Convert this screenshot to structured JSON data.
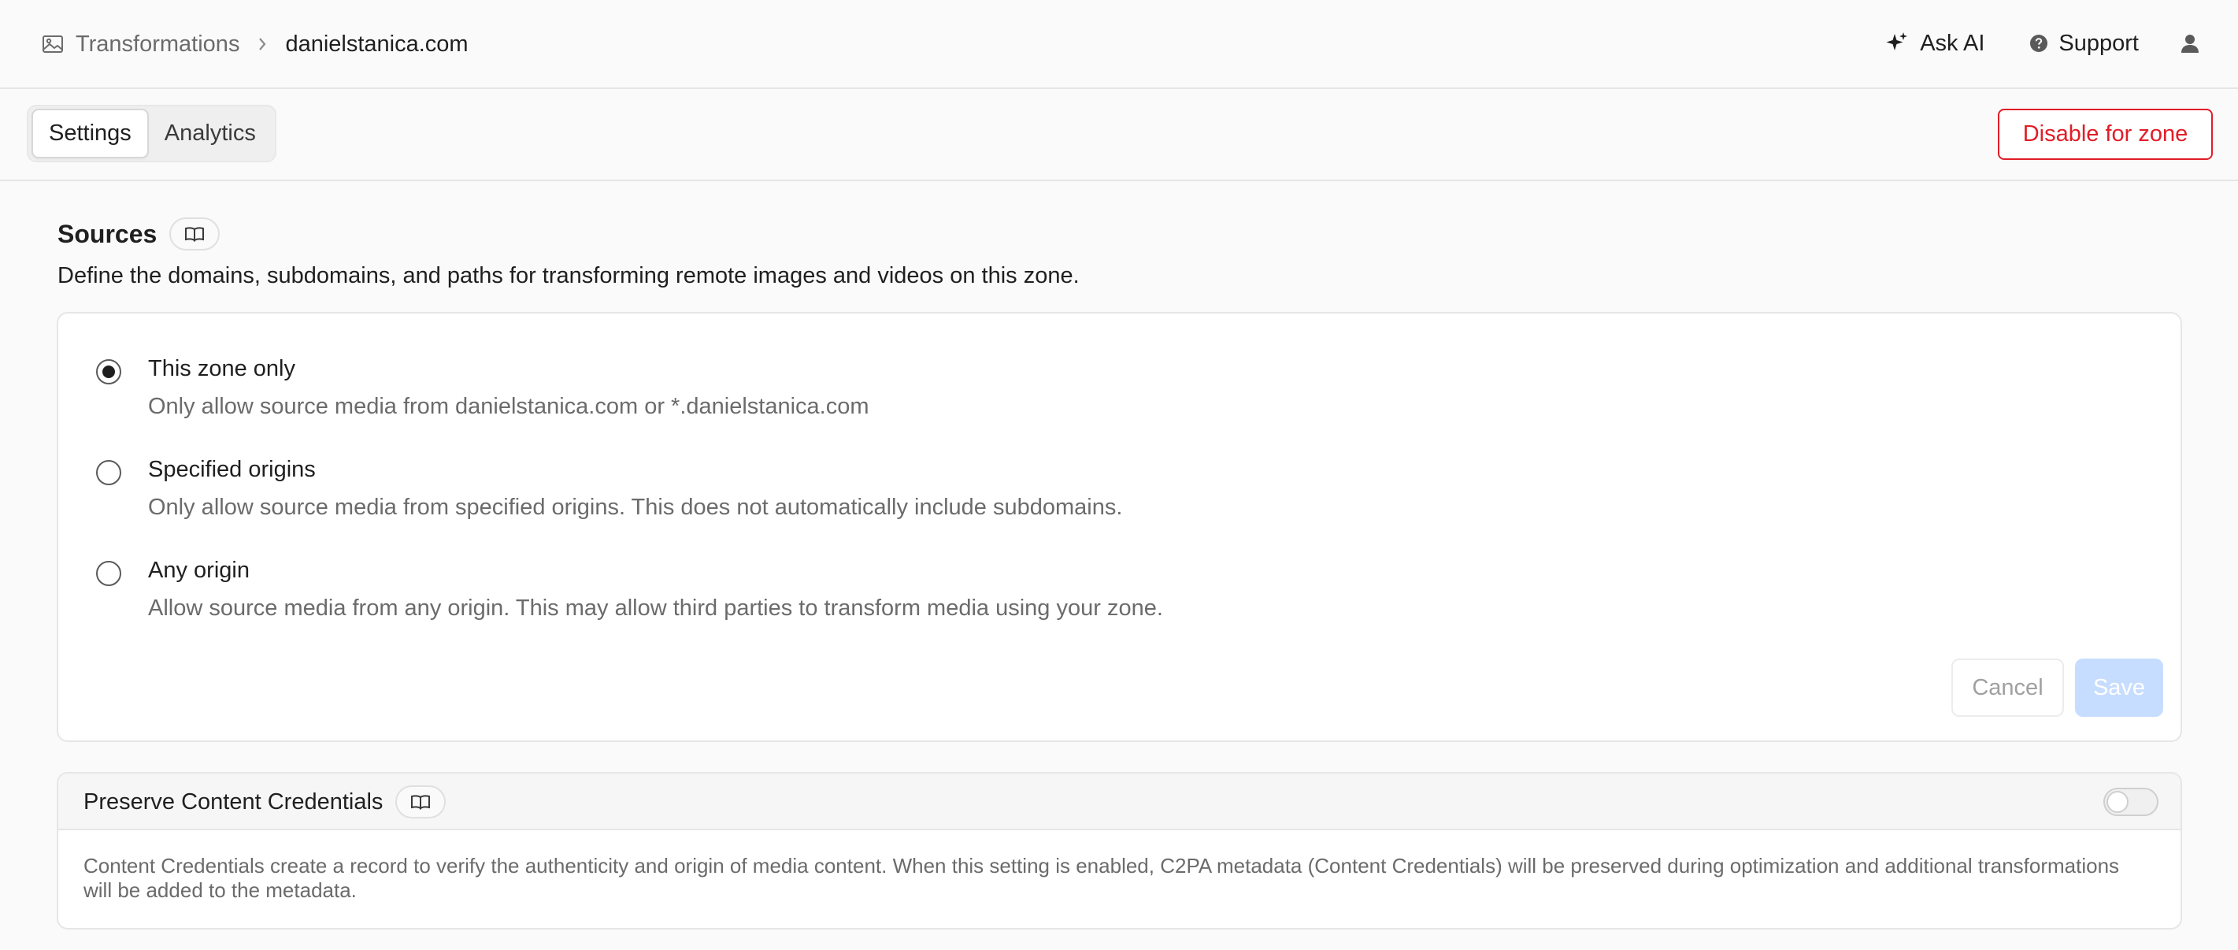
{
  "breadcrumb": {
    "parent": "Transformations",
    "current": "danielstanica.com",
    "parent_icon": "image-icon",
    "separator_icon": "chevron-right-icon"
  },
  "header": {
    "ask_ai_label": "Ask AI",
    "support_label": "Support",
    "ask_ai_icon": "sparkle-icon",
    "support_icon": "help-circle-icon",
    "user_icon": "user-icon"
  },
  "tabs": [
    {
      "label": "Settings",
      "active": true
    },
    {
      "label": "Analytics",
      "active": false
    }
  ],
  "disable_button_label": "Disable for zone",
  "sources": {
    "title": "Sources",
    "doc_icon": "book-icon",
    "description": "Define the domains, subdomains, and paths for transforming remote images and videos on this zone.",
    "options": [
      {
        "label": "This zone only",
        "description": "Only allow source media from danielstanica.com or *.danielstanica.com",
        "selected": true
      },
      {
        "label": "Specified origins",
        "description": "Only allow source media from specified origins. This does not automatically include subdomains.",
        "selected": false
      },
      {
        "label": "Any origin",
        "description": "Allow source media from any origin. This may allow third parties to transform media using your zone.",
        "selected": false
      }
    ],
    "cancel_label": "Cancel",
    "save_label": "Save"
  },
  "content_credentials": {
    "title": "Preserve Content Credentials",
    "doc_icon": "book-icon",
    "enabled": false,
    "description": "Content Credentials create a record to verify the authenticity and origin of media content. When this setting is enabled, C2PA metadata (Content Credentials) will be preserved during optimization and additional transformations will be added to the metadata."
  },
  "colors": {
    "danger": "#e11d27",
    "save_disabled": "#c7ddff",
    "muted_text": "#6b6b6b"
  }
}
